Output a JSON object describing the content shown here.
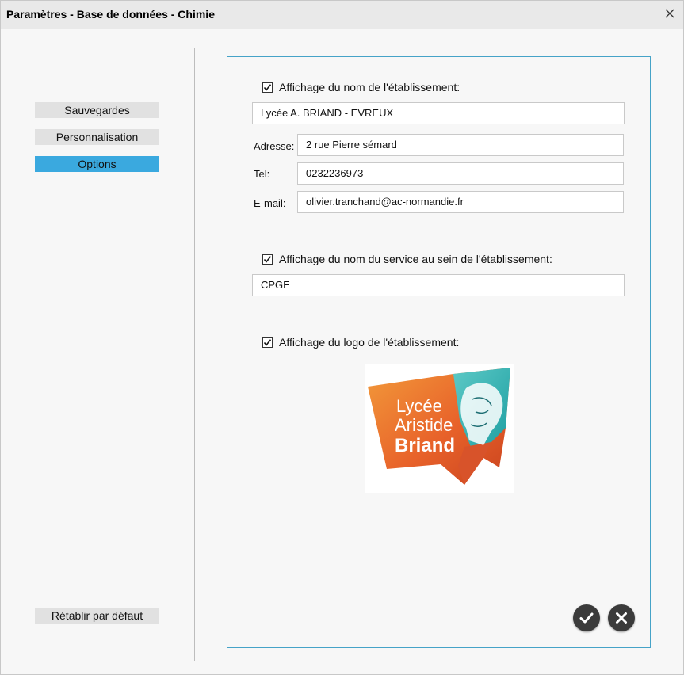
{
  "window": {
    "title": "Paramètres - Base de données - Chimie"
  },
  "sidebar": {
    "items": [
      {
        "label": "Sauvegardes",
        "active": false
      },
      {
        "label": "Personnalisation",
        "active": false
      },
      {
        "label": "Options",
        "active": true
      }
    ],
    "reset_label": "Rétablir par défaut"
  },
  "options": {
    "institution": {
      "checkbox_label": "Affichage du nom de l'établissement:",
      "checked": true,
      "name": "Lycée A. BRIAND - EVREUX",
      "address_label": "Adresse:",
      "address": "2 rue Pierre sémard",
      "tel_label": "Tel:",
      "tel": "0232236973",
      "email_label": "E-mail:",
      "email": "olivier.tranchand@ac-normandie.fr"
    },
    "service": {
      "checkbox_label": "Affichage du nom du service au sein de l'établissement:",
      "checked": true,
      "name": "CPGE"
    },
    "logo": {
      "checkbox_label": "Affichage du logo de l'établissement:",
      "checked": true,
      "text_line1": "Lycée",
      "text_line2": "Aristide",
      "text_line3": "Briand"
    }
  },
  "colors": {
    "accent": "#3aa9df",
    "panel_border": "#46a3c8",
    "logo_orange": "#e8622a",
    "logo_teal": "#2bb3b1"
  },
  "icons": {
    "close": "close-icon",
    "confirm": "check-icon",
    "cancel": "x-icon"
  }
}
